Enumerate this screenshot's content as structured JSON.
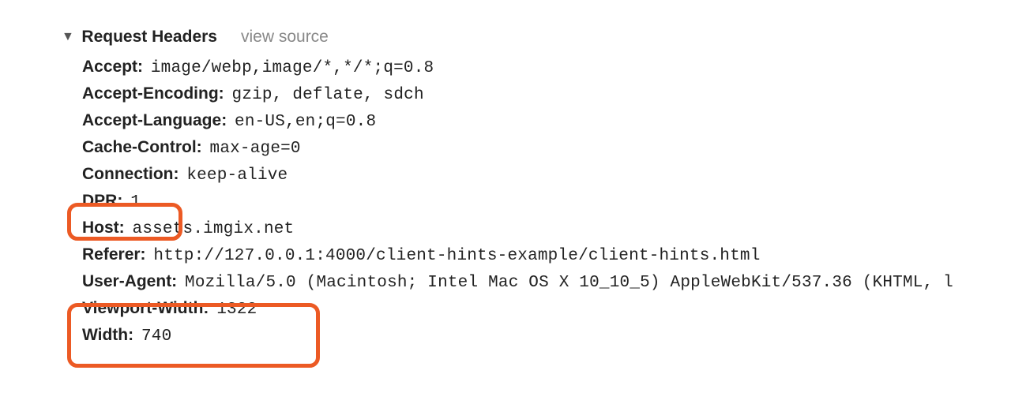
{
  "section": {
    "title": "Request Headers",
    "viewSource": "view source"
  },
  "headers": {
    "accept": {
      "key": "Accept:",
      "value": "image/webp,image/*,*/*;q=0.8"
    },
    "acceptEncoding": {
      "key": "Accept-Encoding:",
      "value": "gzip, deflate, sdch"
    },
    "acceptLanguage": {
      "key": "Accept-Language:",
      "value": "en-US,en;q=0.8"
    },
    "cacheControl": {
      "key": "Cache-Control:",
      "value": "max-age=0"
    },
    "connection": {
      "key": "Connection:",
      "value": "keep-alive"
    },
    "dpr": {
      "key": "DPR:",
      "value": "1"
    },
    "host": {
      "key": "Host:",
      "value": "assets.imgix.net"
    },
    "referer": {
      "key": "Referer:",
      "value": "http://127.0.0.1:4000/client-hints-example/client-hints.html"
    },
    "userAgent": {
      "key": "User-Agent:",
      "value": "Mozilla/5.0 (Macintosh; Intel Mac OS X 10_10_5) AppleWebKit/537.36 (KHTML, l"
    },
    "viewportWidth": {
      "key": "Viewport-Width:",
      "value": "1322"
    },
    "width": {
      "key": "Width:",
      "value": "740"
    }
  }
}
